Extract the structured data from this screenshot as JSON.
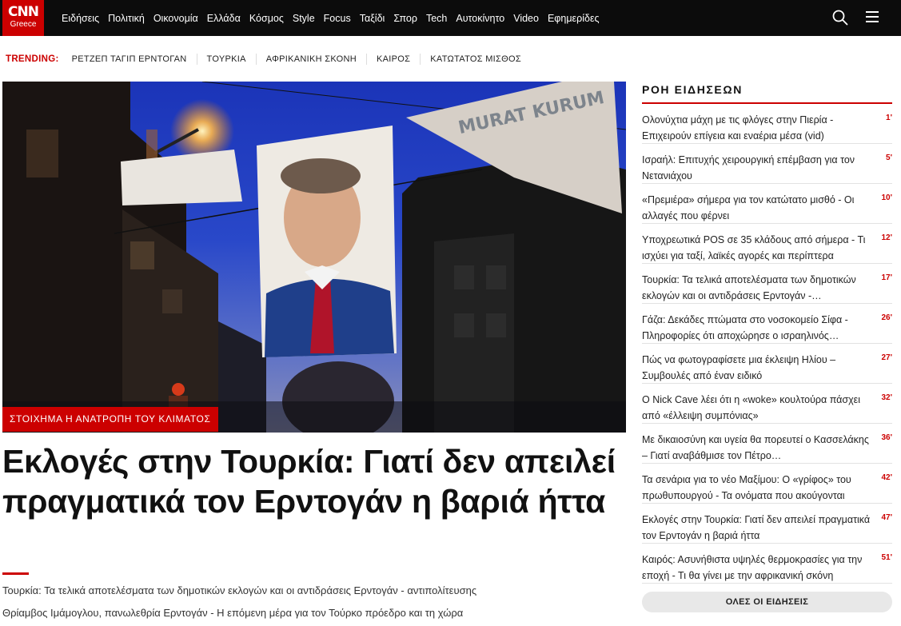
{
  "logo": {
    "brand": "CNN",
    "edition": "Greece"
  },
  "nav": {
    "items": [
      "Ειδήσεις",
      "Πολιτική",
      "Οικονομία",
      "Ελλάδα",
      "Κόσμος",
      "Style",
      "Focus",
      "Ταξίδι",
      "Σπορ",
      "Tech",
      "Αυτοκίνητο",
      "Video",
      "Εφημερίδες"
    ],
    "search_icon": "search-icon",
    "menu_icon": "hamburger-menu-icon"
  },
  "trending": {
    "label": "TRENDING:",
    "items": [
      "ΡΕΤΖΕΠ ΤΑΓΙΠ ΕΡΝΤΟΓΑΝ",
      "ΤΟΥΡΚΙΑ",
      "ΑΦΡΙΚΑΝΙΚΗ ΣΚΟΝΗ",
      "ΚΑΙΡΟΣ",
      "ΚΑΤΩΤΑΤΟΣ ΜΙΣΘΟΣ"
    ]
  },
  "hero": {
    "badge": "ΣΤΟΙΧΗΜΑ Η ΑΝΑΤΡΟΠΗ ΤΟΥ ΚΛΙΜΑΤΟΣ",
    "banner_text": "MURAT KURUM",
    "headline": "Εκλογές στην Τουρκία: Γιατί δεν απειλεί πραγματικά τον Ερντογάν η βαριά ήττα",
    "related": [
      "Τουρκία: Τα τελικά αποτελέσματα των δημοτικών εκλογών και οι αντιδράσεις Ερντογάν - αντιπολίτευσης",
      "Θρίαμβος Ιμάμογλου, πανωλεθρία Ερντογάν - Η επόμενη μέρα για τον Τούρκο πρόεδρο και τη χώρα"
    ]
  },
  "sidebar": {
    "title": "ΡΟΗ ΕΙΔΗΣΕΩΝ",
    "items": [
      {
        "text": "Ολονύχτια μάχη με τις φλόγες στην Πιερία - Επιχειρούν επίγεια και εναέρια μέσα (vid)",
        "time": "1'"
      },
      {
        "text": "Ισραήλ: Επιτυχής χειρουργική επέμβαση για τον Νετανιάχου",
        "time": "5'"
      },
      {
        "text": "«Πρεμιέρα» σήμερα για τον κατώτατο μισθό - Οι αλλαγές που φέρνει",
        "time": "10'"
      },
      {
        "text": "Υποχρεωτικά POS σε 35 κλάδους από σήμερα - Τι ισχύει για ταξί, λαϊκές αγορές και περίπτερα",
        "time": "12'"
      },
      {
        "text": "Τουρκία: Τα τελικά αποτελέσματα των δημοτικών εκλογών και οι αντιδράσεις Ερντογάν -…",
        "time": "17'"
      },
      {
        "text": "Γάζα: Δεκάδες πτώματα στο νοσοκομείο Σίφα - Πληροφορίες ότι αποχώρησε ο ισραηλινός…",
        "time": "26'"
      },
      {
        "text": "Πώς να φωτογραφίσετε μια έκλειψη Ηλίου – Συμβουλές από έναν ειδικό",
        "time": "27'"
      },
      {
        "text": "O Nick Cave λέει ότι η «woke» κουλτούρα πάσχει από «έλλειψη συμπόνιας»",
        "time": "32'"
      },
      {
        "text": "Με δικαιοσύνη και υγεία θα πορευτεί ο Κασσελάκης – Γιατί αναβάθμισε τον Πέτρο…",
        "time": "36'"
      },
      {
        "text": "Τα σενάρια για το νέο Μαξίμου: Ο «γρίφος» του πρωθυπουργού - Τα ονόματα που ακούγονται",
        "time": "42'"
      },
      {
        "text": "Εκλογές στην Τουρκία: Γιατί δεν απειλεί πραγματικά τον Ερντογάν η βαριά ήττα",
        "time": "47'"
      },
      {
        "text": "Καιρός: Ασυνήθιστα υψηλές θερμοκρασίες για την εποχή - Τι θα γίνει με την αφρικανική σκόνη",
        "time": "51'"
      }
    ],
    "all_news": "ΟΛΕΣ ΟΙ ΕΙΔΗΣΕΙΣ"
  },
  "colors": {
    "brand_red": "#cc0000",
    "topbar": "#0c0c0c"
  }
}
